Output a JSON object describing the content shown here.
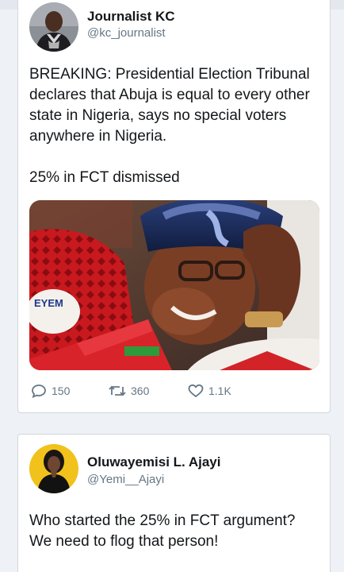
{
  "tweets": [
    {
      "name": "Journalist KC",
      "handle": "@kc_journalist",
      "text": "BREAKING: Presidential Election Tribunal declares that Abuja is equal to every other state in Nigeria, says no special voters anywhere in Nigeria.",
      "text2": "25% in FCT dismissed",
      "counts": {
        "replies": "150",
        "retweets": "360",
        "likes": "1.1K"
      },
      "icons": {
        "reply": "reply-icon",
        "retweet": "retweet-icon",
        "like": "like-icon"
      }
    },
    {
      "name": "Oluwayemisi L. Ajayi",
      "handle": "@Yemi__Ajayi",
      "text": "Who started the 25% in FCT argument? We need to flog that person!"
    }
  ],
  "colors": {
    "background": "#eef1f5",
    "card": "#ffffff",
    "secondary_text": "#657786",
    "border": "#d3d7dc"
  }
}
